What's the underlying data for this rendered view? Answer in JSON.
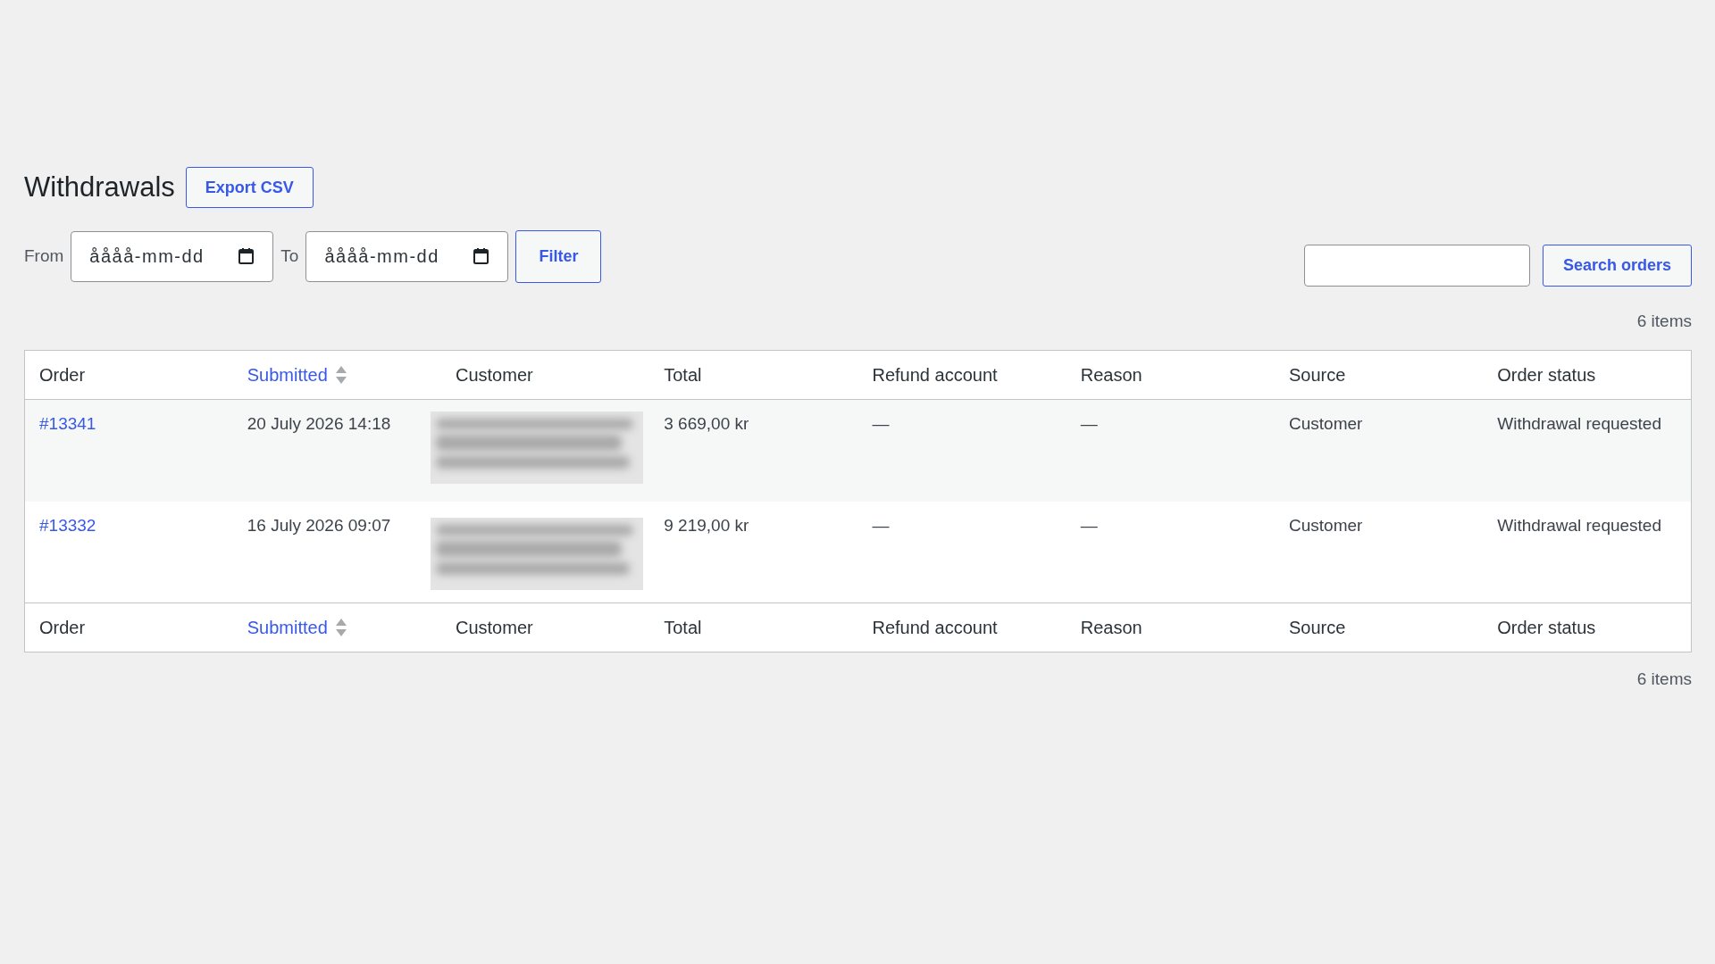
{
  "page": {
    "title": "Withdrawals"
  },
  "export_button": {
    "label": "Export CSV"
  },
  "date_filter": {
    "from_label": "From",
    "from_field": {
      "placeholder": "åååå-mm-dd"
    },
    "to_label": "To",
    "to_field": {
      "placeholder": "åååå-mm-dd"
    },
    "button": "Filter"
  },
  "search": {
    "button": "Search orders"
  },
  "items_count_top": "6 items",
  "table": {
    "columns": [
      {
        "label": "Order",
        "sortable": false
      },
      {
        "label": "Submitted",
        "sortable": true
      },
      {
        "label": "Customer",
        "sortable": false
      },
      {
        "label": "Total",
        "sortable": false
      },
      {
        "label": "Refund account",
        "sortable": false
      },
      {
        "label": "Reason",
        "sortable": false
      },
      {
        "label": "Source",
        "sortable": false
      },
      {
        "label": "Order status",
        "sortable": false
      }
    ],
    "rows": [
      {
        "order": "#13341",
        "submitted": "20 July 2026 14:18",
        "total": "3 669,00 kr",
        "refund_account": "—",
        "reason": "—",
        "source": "Customer",
        "order_status": "Withdrawal requested"
      },
      {
        "order": "#13332",
        "submitted": "16 July 2026 09:07",
        "total": "9 219,00 kr",
        "refund_account": "—",
        "reason": "—",
        "source": "Customer",
        "order_status": "Withdrawal requested"
      }
    ],
    "footer_columns": [
      {
        "label": "Order",
        "sortable": false
      },
      {
        "label": "Submitted",
        "sortable": true
      },
      {
        "label": "Customer",
        "sortable": false
      },
      {
        "label": "Total",
        "sortable": false
      },
      {
        "label": "Refund account",
        "sortable": false
      },
      {
        "label": "Reason",
        "sortable": false
      },
      {
        "label": "Source",
        "sortable": false
      },
      {
        "label": "Order status",
        "sortable": false
      }
    ]
  },
  "items_count_bottom": "6 items"
}
